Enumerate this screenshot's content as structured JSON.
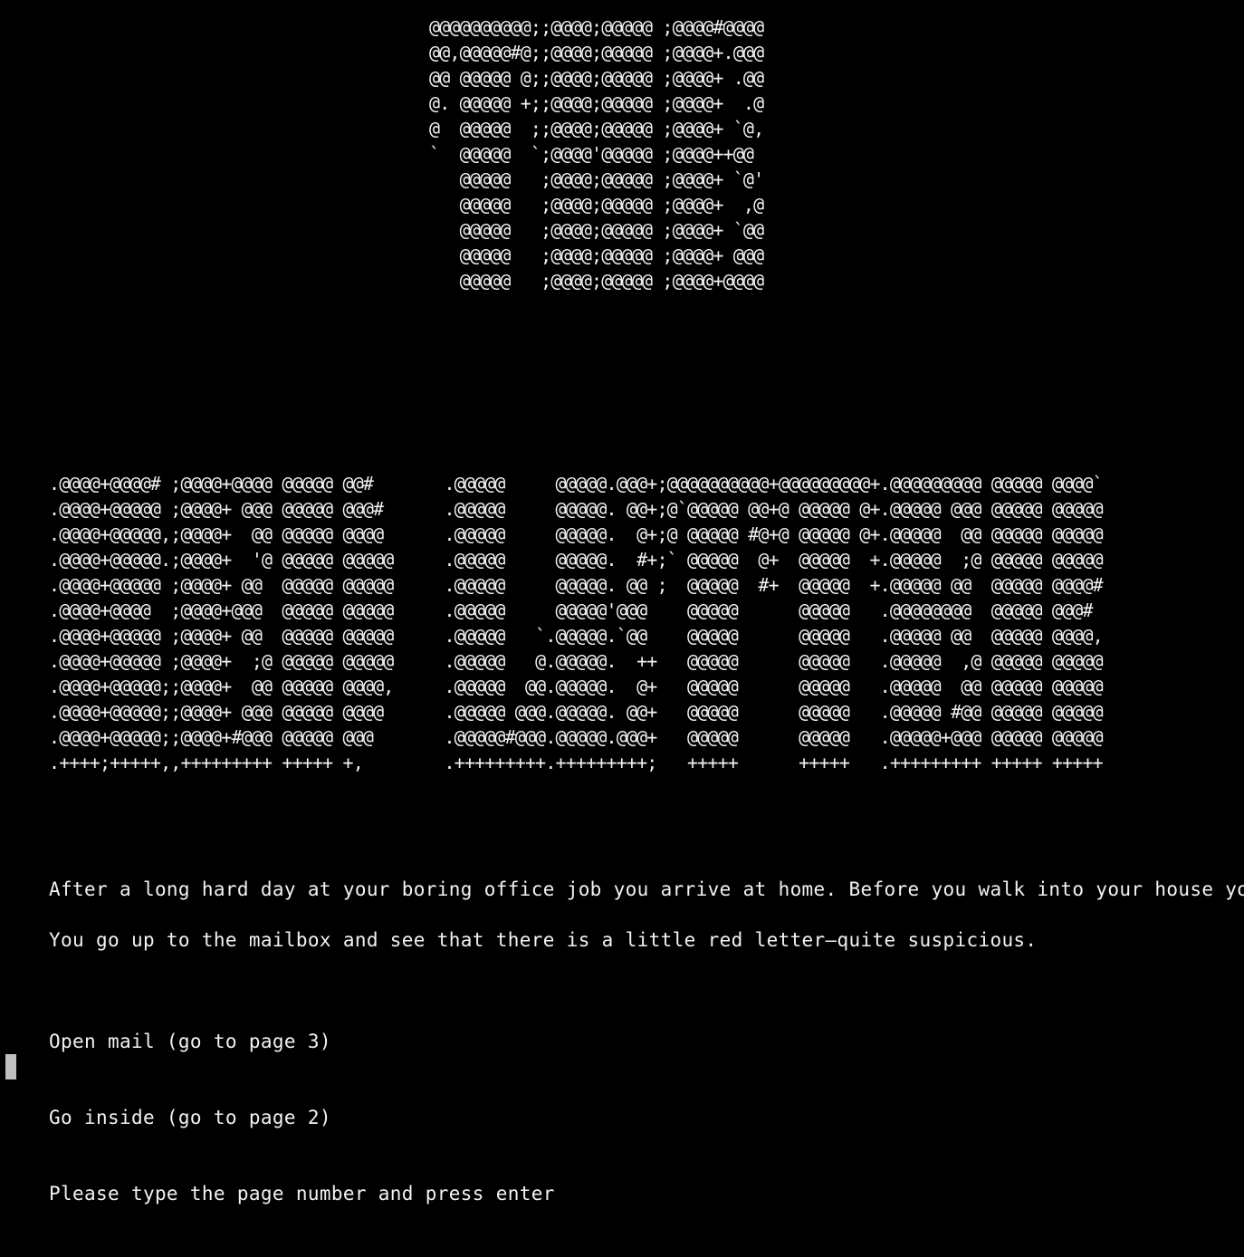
{
  "title_art": [
    "@@@@@@@@@@;;@@@@;@@@@@ ;@@@@#@@@@",
    "@@,@@@@@#@;;@@@@;@@@@@ ;@@@@+.@@@",
    "@@ @@@@@ @;;@@@@;@@@@@ ;@@@@+ .@@",
    "@. @@@@@ +;;@@@@;@@@@@ ;@@@@+  .@",
    "@  @@@@@  ;;@@@@;@@@@@ ;@@@@+ `@,",
    "`  @@@@@  `;@@@@'@@@@@ ;@@@@++@@",
    "   @@@@@   ;@@@@;@@@@@ ;@@@@+ `@'",
    "   @@@@@   ;@@@@;@@@@@ ;@@@@+  ,@",
    "   @@@@@   ;@@@@;@@@@@ ;@@@@+ `@@",
    "   @@@@@   ;@@@@;@@@@@ ;@@@@+ @@@",
    "   @@@@@   ;@@@@;@@@@@ ;@@@@+@@@@"
  ],
  "banner_art": [
    ".@@@@+@@@@# ;@@@@+@@@@ @@@@@ @@#       .@@@@@     @@@@@.@@@+;@@@@@@@@@@+@@@@@@@@@+.@@@@@@@@@ @@@@@ @@@@`",
    ".@@@@+@@@@@ ;@@@@+ @@@ @@@@@ @@@#      .@@@@@     @@@@@. @@+;@`@@@@@ @@+@ @@@@@ @+.@@@@@ @@@ @@@@@ @@@@@",
    ".@@@@+@@@@@,;@@@@+  @@ @@@@@ @@@@      .@@@@@     @@@@@.  @+;@ @@@@@ #@+@ @@@@@ @+.@@@@@  @@ @@@@@ @@@@@",
    ".@@@@+@@@@@.;@@@@+  '@ @@@@@ @@@@@     .@@@@@     @@@@@.  #+;` @@@@@  @+  @@@@@  +.@@@@@  ;@ @@@@@ @@@@@",
    ".@@@@+@@@@@ ;@@@@+ @@  @@@@@ @@@@@     .@@@@@     @@@@@. @@ ;  @@@@@  #+  @@@@@  +.@@@@@ @@  @@@@@ @@@@#",
    ".@@@@+@@@@  ;@@@@+@@@  @@@@@ @@@@@     .@@@@@     @@@@@'@@@    @@@@@      @@@@@   .@@@@@@@@  @@@@@ @@@#",
    ".@@@@+@@@@@ ;@@@@+ @@  @@@@@ @@@@@     .@@@@@   `.@@@@@.`@@    @@@@@      @@@@@   .@@@@@ @@  @@@@@ @@@@,",
    ".@@@@+@@@@@ ;@@@@+  ;@ @@@@@ @@@@@     .@@@@@   @.@@@@@.  ++   @@@@@      @@@@@   .@@@@@  ,@ @@@@@ @@@@@",
    ".@@@@+@@@@@;;@@@@+  @@ @@@@@ @@@@,     .@@@@@  @@.@@@@@.  @+   @@@@@      @@@@@   .@@@@@  @@ @@@@@ @@@@@",
    ".@@@@+@@@@@;;@@@@+ @@@ @@@@@ @@@@      .@@@@@ @@@.@@@@@. @@+   @@@@@      @@@@@   .@@@@@ #@@ @@@@@ @@@@@",
    ".@@@@+@@@@@;;@@@@+#@@@ @@@@@ @@@       .@@@@@#@@@.@@@@@.@@@+   @@@@@      @@@@@   .@@@@@+@@@ @@@@@ @@@@@",
    ".++++;+++++,,+++++++++ +++++ +,        .+++++++++.+++++++++;   +++++      +++++   .+++++++++ +++++ +++++"
  ],
  "story": {
    "intro": "After a long hard day at your boring office job you arrive at home. Before you walk into your house you see a",
    "mailbox": "You go up to the mailbox and see that there is a little red letter—quite suspicious.",
    "choice_open_mail": "Open mail (go to page 3)",
    "choice_go_inside": "Go inside (go to page 2)",
    "prompt": "Please type the page number and press enter"
  }
}
